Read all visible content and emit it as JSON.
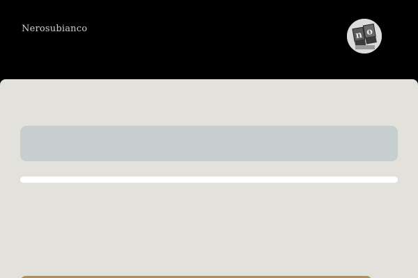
{
  "header": {
    "brand": "Nerosubianco",
    "avatar_icon": "profile-photo-typeface-icon"
  },
  "main": {
    "search": {
      "value": "",
      "placeholder": ""
    },
    "progress": {
      "fraction": 1.0
    },
    "bottom_button": {
      "label": ""
    }
  },
  "colors": {
    "background": "#000000",
    "panel": "#e2e1dc",
    "input": "#c6ced0",
    "track": "#ffffff",
    "accent": "#b58d52",
    "brand_text": "#cfcfcf"
  }
}
